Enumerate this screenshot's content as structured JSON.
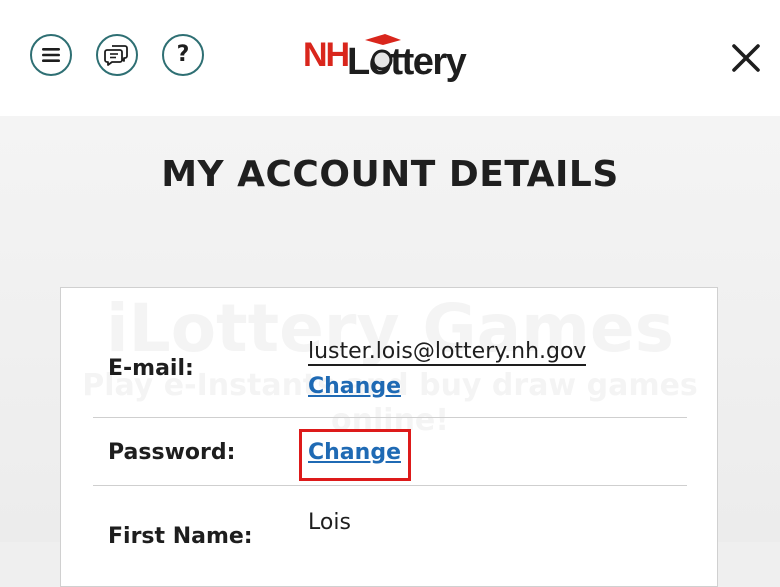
{
  "header": {
    "menu_icon": "hamburger-menu-icon",
    "chat_icon": "chat-bubbles-icon",
    "help_icon": "question-mark-icon",
    "help_glyph": "?",
    "logo_text_nh": "NH",
    "logo_text_lottery": "Lottery",
    "close_icon": "close-x-icon"
  },
  "page": {
    "title": "MY ACCOUNT DETAILS"
  },
  "watermark": {
    "title": "iLottery Games",
    "subtitle": "Play e-Instants and buy draw games online!"
  },
  "account": {
    "email_label": "E-mail:",
    "email_value": "luster.lois@lottery.nh.gov",
    "email_change": "Change",
    "password_label": "Password:",
    "password_change": "Change",
    "first_name_label": "First Name:",
    "first_name_value": "Lois"
  },
  "colors": {
    "accent_teal": "#2e6f73",
    "link_blue": "#1f6ab4",
    "logo_red": "#d9261c",
    "highlight_red": "#dd1a1a"
  }
}
